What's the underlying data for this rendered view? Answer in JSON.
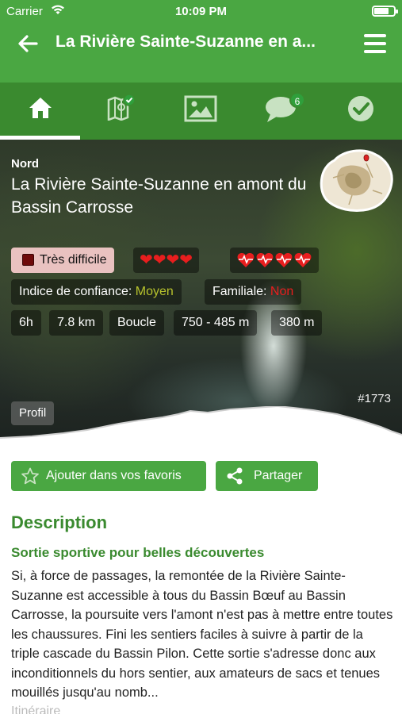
{
  "status_bar": {
    "carrier": "Carrier",
    "time": "10:09 PM"
  },
  "nav": {
    "title": "La Rivière Sainte-Suzanne en a...",
    "back_icon": "arrow-left-icon",
    "menu_icon": "hamburger-menu-icon"
  },
  "tabs": [
    {
      "icon": "home-icon",
      "active": true
    },
    {
      "icon": "map-check-icon",
      "active": false
    },
    {
      "icon": "image-icon",
      "active": false
    },
    {
      "icon": "comments-icon",
      "active": false,
      "badge": "6"
    },
    {
      "icon": "check-circle-icon",
      "active": false
    }
  ],
  "hero": {
    "region": "Nord",
    "title": "La Rivière Sainte-Suzanne en amont du Bassin Carrosse",
    "difficulty": "Très difficile",
    "effort_hearts": 4,
    "effort_pulses": 4,
    "confidence_label": "Indice de confiance:",
    "confidence_value": "Moyen",
    "family_label": "Familiale:",
    "family_value": "Non",
    "duration": "6h",
    "distance": "7.8 km",
    "loop": "Boucle",
    "altitude": "750 - 485 m",
    "elevation_gain": "380 m",
    "ref": "#1773",
    "profile_label": "Profil"
  },
  "actions": {
    "favorite": "Ajouter dans vos favoris",
    "share": "Partager"
  },
  "description": {
    "heading": "Description",
    "subheading": "Sortie sportive pour belles découvertes",
    "text": "Si, à force de passages, la remontée de la Rivière Sainte-Suzanne est accessible à tous du Bassin Bœuf au Bassin Carrosse, la poursuite vers l'amont n'est pas à mettre entre toutes les chaussures. Fini les sentiers faciles à suivre à partir de la triple cascade du Bassin Pilon. Cette sortie s'adresse donc aux inconditionnels du hors sentier, aux amateurs de sacs et tenues mouillés jusqu'au nomb...",
    "next_partial": "Itinéraire"
  },
  "colors": {
    "primary": "#4aa742",
    "primary_dark": "#3a8a2f",
    "danger": "#e81e1e",
    "difficulty_bg": "#e9c2c0"
  }
}
